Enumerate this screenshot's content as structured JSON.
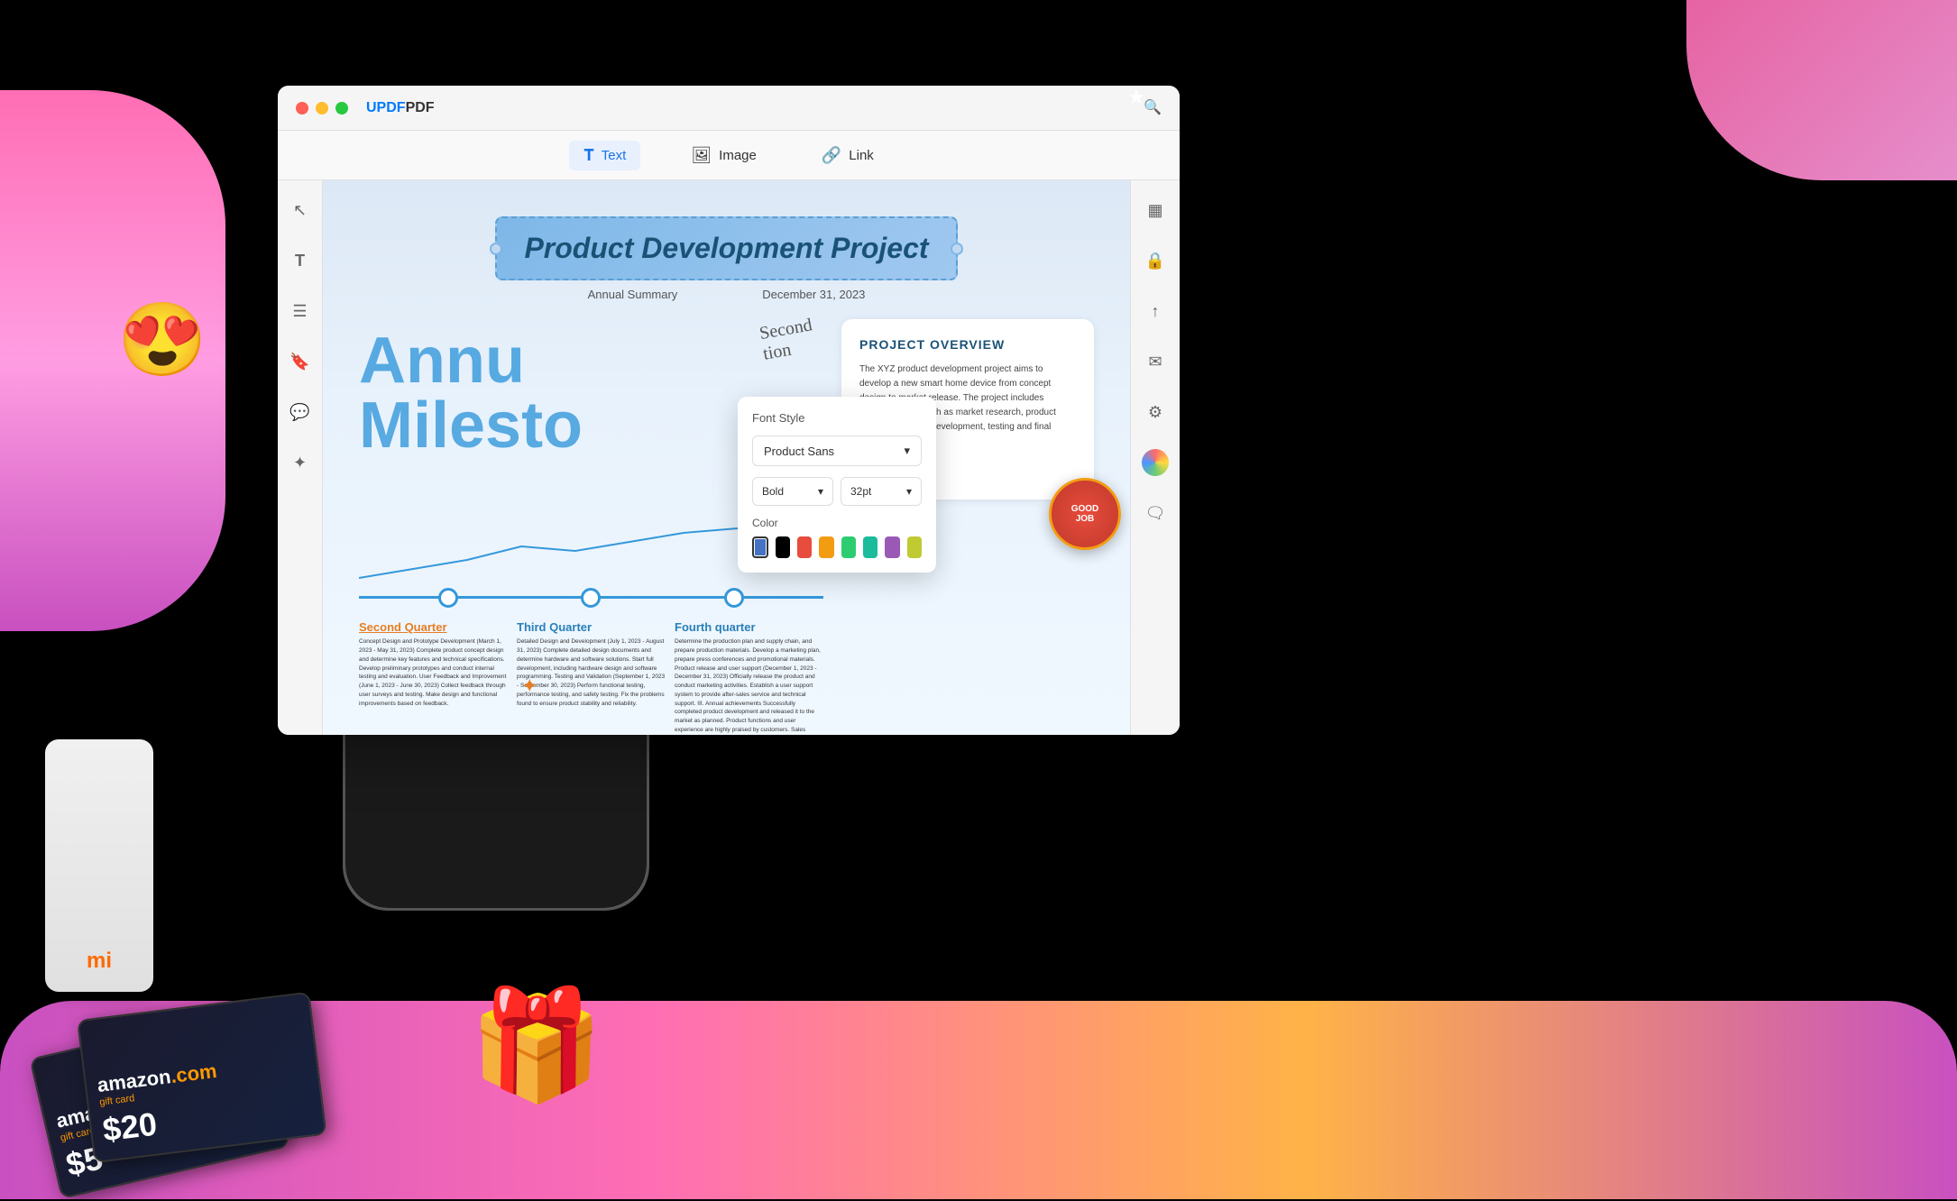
{
  "app": {
    "title": "UPDF",
    "title_color": "#007bff"
  },
  "window": {
    "controls": {
      "close": "close",
      "minimize": "minimize",
      "maximize": "maximize"
    }
  },
  "toolbar": {
    "items": [
      {
        "id": "text",
        "label": "Text",
        "icon": "T",
        "active": true
      },
      {
        "id": "image",
        "label": "Image",
        "icon": "🖼",
        "active": false
      },
      {
        "id": "link",
        "label": "Link",
        "icon": "🔗",
        "active": false
      }
    ],
    "search_icon": "🔍"
  },
  "left_sidebar": {
    "icons": [
      {
        "id": "cursor",
        "symbol": "↖",
        "label": "cursor"
      },
      {
        "id": "text-edit",
        "symbol": "T",
        "label": "text-edit"
      },
      {
        "id": "pages",
        "symbol": "≡",
        "label": "pages"
      },
      {
        "id": "bookmark",
        "symbol": "🔖",
        "label": "bookmark"
      },
      {
        "id": "comment",
        "symbol": "💬",
        "label": "comment"
      },
      {
        "id": "stamp",
        "symbol": "✦",
        "label": "stamp"
      }
    ]
  },
  "right_sidebar": {
    "icons": [
      {
        "id": "ocr",
        "symbol": "▦",
        "label": "ocr"
      },
      {
        "id": "protect",
        "symbol": "🔒",
        "label": "protect"
      },
      {
        "id": "share",
        "symbol": "↑",
        "label": "share"
      },
      {
        "id": "email",
        "symbol": "✉",
        "label": "email"
      },
      {
        "id": "tools",
        "symbol": "⚙",
        "label": "tools"
      },
      {
        "id": "chat",
        "symbol": "💬",
        "label": "chat"
      },
      {
        "id": "color-wheel",
        "symbol": "◉",
        "label": "color-wheel"
      },
      {
        "id": "message",
        "symbol": "🗨",
        "label": "message"
      }
    ]
  },
  "document": {
    "title": "Product Development Project",
    "subtitle_left": "Annual Summary",
    "subtitle_right": "December 31, 2023",
    "large_text_line1": "Annu",
    "large_text_line2": "Milesto",
    "project_overview": {
      "title": "PROJECT OVERVIEW",
      "text": "The XYZ product development project aims to develop a new smart home device from concept design to market release. The project includes multiple stages such as market research, product design, prototype development, testing and final release."
    },
    "quarters": [
      {
        "id": "second",
        "title": "Second Quarter",
        "title_color": "#e67e22",
        "content": "Concept Design and Prototype Development (March 1, 2023 - May 31, 2023)\nComplete product concept design and determine key features and technical specifications.\nDevelop preliminary prototypes and conduct internal testing and evaluation.\nUser Feedback and Improvement (June 1, 2023 - June 30, 2023)\nCollect feedback through user surveys and testing.\nMake design and functional improvements based on feedback."
      },
      {
        "id": "third",
        "title": "Third Quarter",
        "title_color": "#2980b9",
        "content": "Detailed Design and Development (July 1, 2023 - August 31, 2023)\nComplete detailed design documents and determine hardware and software solutions.\nStart full development, including hardware design and software programming.\nTesting and Validation (September 1, 2023 - September 30, 2023)\nPerform functional testing, performance testing, and safety testing.\nFix the problems found to ensure product stability and reliability."
      },
      {
        "id": "fourth",
        "title": "Fourth quarter",
        "title_color": "#2980b9",
        "content": "Determine the production plan and supply chain, and prepare production materials.\nDevelop a marketing plan, prepare press conferences and promotional materials.\nProduct release and user support (December 1, 2023 - December 31, 2023)\nOfficially release the product and conduct marketing activities.\nEstablish a user support system to provide after-sales service and technical support.\nIII. Annual achievements\nSuccessfully completed product development and released it to the market as planned.\nProduct functions and user experience are highly praised by customers.\nSales reached the expected target and the market response was good."
      }
    ]
  },
  "font_style_popup": {
    "title": "Font Style",
    "font_name": "Product Sans",
    "font_name_dropdown_arrow": "▾",
    "style": "Bold",
    "style_dropdown_arrow": "▾",
    "size": "32pt",
    "size_dropdown_arrow": "▾",
    "color_label": "Color",
    "colors": [
      {
        "id": "blue",
        "hex": "#4472c4",
        "selected": true
      },
      {
        "id": "black",
        "hex": "#000000"
      },
      {
        "id": "red",
        "hex": "#e74c3c"
      },
      {
        "id": "orange",
        "hex": "#f39c12"
      },
      {
        "id": "green",
        "hex": "#2ecc71"
      },
      {
        "id": "teal",
        "hex": "#1abc9c"
      },
      {
        "id": "purple",
        "hex": "#9b59b6"
      },
      {
        "id": "lime",
        "hex": "#c0ca33"
      }
    ]
  },
  "handwritten": {
    "line1": "Second",
    "line2": "tion"
  },
  "good_job_badge": {
    "line1": "GOOD",
    "line2": "JOB"
  },
  "gift_cards": [
    {
      "id": "card1",
      "amount": "$5",
      "logo": "amazon.com",
      "subtitle": "gift card"
    },
    {
      "id": "card2",
      "amount": "$20",
      "logo": "amazon.com",
      "subtitle": "gift card"
    }
  ],
  "decorative": {
    "sparkle_symbol": "✦",
    "star_symbol": "★",
    "emoji_face": "😍"
  }
}
